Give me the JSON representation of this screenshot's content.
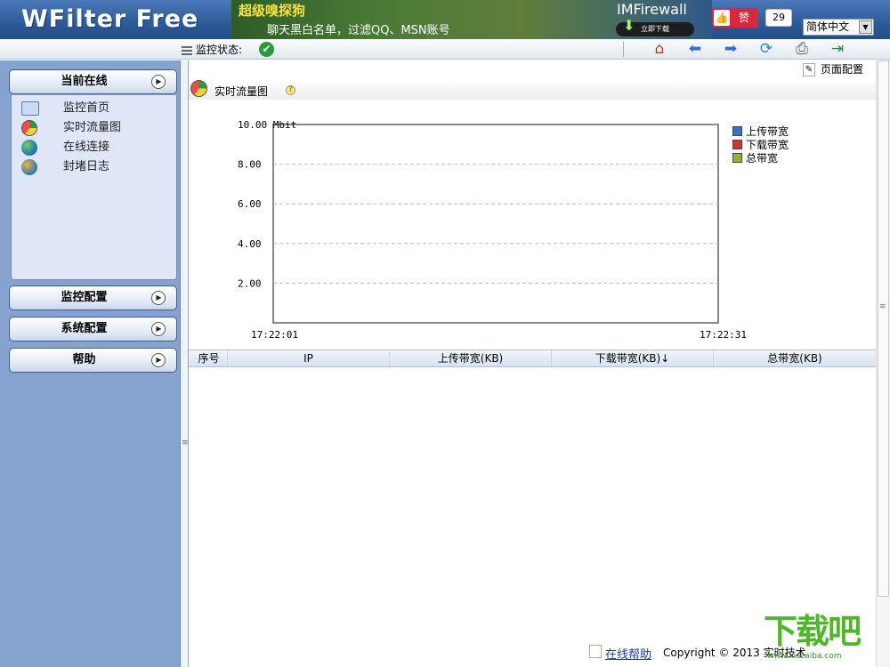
{
  "header": {
    "logo": "WFilter Free",
    "banner_title": "超级嗅探狗",
    "banner_subtitle": "聊天黑白名单，过滤QQ、MSN账号",
    "banner_product": "IMFirewall",
    "banner_download": "立即下载",
    "like_label": "赞",
    "like_count": "29",
    "language": "简体中文"
  },
  "toolbar": {
    "status_label": "监控状态:",
    "status_icon": "check-circle-icon",
    "icons": [
      "home-icon",
      "back-icon",
      "forward-icon",
      "refresh-icon",
      "print-icon",
      "exit-icon"
    ]
  },
  "sidebar": {
    "panels": [
      {
        "label": "当前在线"
      },
      {
        "label": "监控配置"
      },
      {
        "label": "系统配置"
      },
      {
        "label": "帮助"
      }
    ],
    "items": [
      {
        "label": "监控首页",
        "icon": "monitor-icon"
      },
      {
        "label": "实时流量图",
        "icon": "pie-chart-icon"
      },
      {
        "label": "在线连接",
        "icon": "globe-icon"
      },
      {
        "label": "封堵日志",
        "icon": "log-globe-icon"
      }
    ]
  },
  "main": {
    "page_config": "页面配置",
    "title": "实时流量图",
    "help_icon": "?",
    "footer_link": "在线帮助",
    "footer_copyright": "Copyright © 2013  实时技术"
  },
  "chart_data": {
    "type": "line",
    "y_tick_labels": [
      "10.00 Mbit",
      "8.00",
      "6.00",
      "4.00",
      "2.00"
    ],
    "y_ticks": [
      10,
      8,
      6,
      4,
      2
    ],
    "ylim": [
      0,
      10
    ],
    "x_tick_labels": [
      "17:22:01",
      "17:22:31"
    ],
    "grid": true,
    "legend_position": "right",
    "series": [
      {
        "name": "上传带宽",
        "color": "#3a6fc4",
        "values": []
      },
      {
        "name": "下载带宽",
        "color": "#c8363a",
        "values": []
      },
      {
        "name": "总带宽",
        "color": "#8fb63a",
        "values": []
      }
    ]
  },
  "table": {
    "columns": [
      "序号",
      "IP",
      "上传带宽(KB)",
      "下载带宽(KB)↓",
      "总带宽(KB)"
    ],
    "rows": []
  },
  "watermark": {
    "text": "下载吧",
    "url": "www.xiazaiba.com"
  }
}
